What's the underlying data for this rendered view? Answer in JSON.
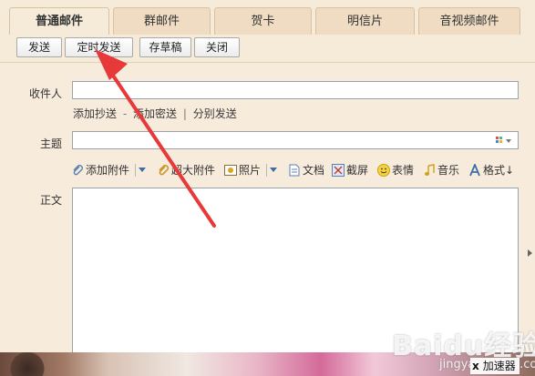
{
  "tabs": [
    {
      "label": "普通邮件",
      "active": true
    },
    {
      "label": "群邮件",
      "active": false
    },
    {
      "label": "贺卡",
      "active": false
    },
    {
      "label": "明信片",
      "active": false
    },
    {
      "label": "音视频邮件",
      "active": false
    }
  ],
  "toolbar": {
    "send": "发送",
    "timed_send": "定时发送",
    "save_draft": "存草稿",
    "close": "关闭"
  },
  "compose": {
    "to_label": "收件人",
    "to_value": "",
    "cc_links": {
      "add_cc": "添加抄送",
      "dash": "-",
      "add_bcc": "添加密送",
      "bar": "|",
      "separate_send": "分别发送"
    },
    "subject_label": "主题",
    "subject_value": "",
    "body_label": "正文",
    "body_value": ""
  },
  "attach_bar": {
    "add_attachment": "添加附件",
    "large_attachment": "超大附件",
    "photo": "照片",
    "document": "文档",
    "screenshot": "截屏",
    "emoji": "表情",
    "music": "音乐",
    "format": "格式↓"
  },
  "watermark": {
    "text": "Baidu经验",
    "sub": "jingyan.baidu.com"
  },
  "accelerator": {
    "mark": "x",
    "label": "加速器"
  },
  "colors": {
    "annotation_arrow": "#e8393a",
    "tab_bg": "#efdcc3",
    "form_bg": "#f7ebdc"
  }
}
